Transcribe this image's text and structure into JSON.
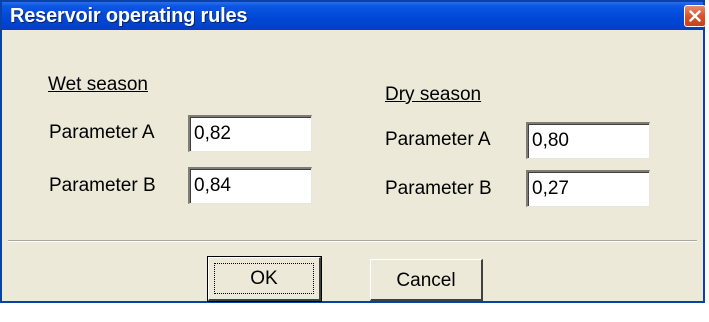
{
  "window": {
    "title": "Reservoir operating rules"
  },
  "wet": {
    "heading": "Wet season",
    "param_a_label": "Parameter A",
    "param_a_value": "0,82",
    "param_b_label": "Parameter B",
    "param_b_value": "0,84"
  },
  "dry": {
    "heading": "Dry season",
    "param_a_label": "Parameter A",
    "param_a_value": "0,80",
    "param_b_label": "Parameter B",
    "param_b_value": "0,27"
  },
  "buttons": {
    "ok": "OK",
    "cancel": "Cancel"
  },
  "icons": {
    "close": "close-icon"
  },
  "colors": {
    "titlebar": "#0047d6",
    "close": "#d9532c",
    "dialog_bg": "#ece9d8"
  }
}
